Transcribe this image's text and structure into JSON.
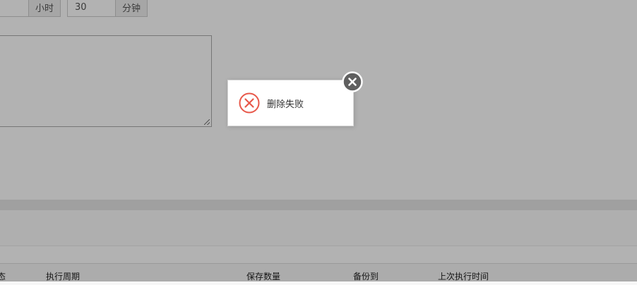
{
  "form": {
    "hours": {
      "value": "",
      "unit": "小时"
    },
    "minutes": {
      "value": "30",
      "unit": "分钟"
    },
    "description": {
      "value": ""
    }
  },
  "table": {
    "headers": [
      "态",
      "执行周期",
      "保存数量",
      "备份到",
      "上次执行时间"
    ]
  },
  "dialog": {
    "message": "删除失败",
    "icon": "error-circle-icon",
    "close_icon": "close-circle-icon"
  },
  "colors": {
    "error": "#e8584a",
    "close_button": "#5f5f5f",
    "overlay": "rgba(0,0,0,0.3)"
  }
}
